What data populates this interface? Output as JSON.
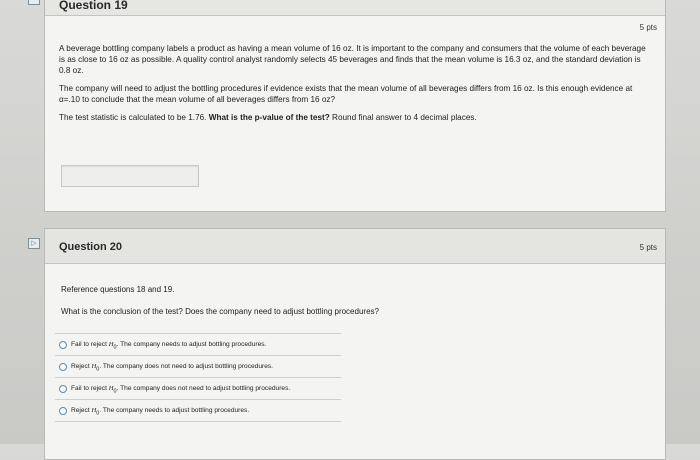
{
  "q19": {
    "title": "Question 19",
    "points": "5 pts",
    "p1": "A beverage bottling company labels a product as having a mean volume of 16 oz. It is important to the company and consumers that the volume of each beverage is as close to 16 oz as possible. A quality control analyst randomly selects 45 beverages and finds that the mean volume is 16.3 oz, and the standard deviation is 0.8 oz.",
    "p2": "The company will need to adjust the bottling procedures if evidence exists that the mean volume of all beverages differs from 16 oz. Is this enough evidence at α=.10 to conclude that the mean volume of all beverages differs from 16 oz?",
    "p3_plain": "The test statistic is calculated to be 1.76.",
    "p3_bold": "What is the p-value of the test?",
    "p3_tail": "Round final answer to 4 decimal places.",
    "answer_value": ""
  },
  "q20": {
    "title": "Question 20",
    "points": "5 pts",
    "reference": "Reference questions 18 and 19.",
    "question": "What is the conclusion of the test? Does the company need to adjust bottling procedures?",
    "choices": [
      {
        "lead": "Fail to reject ",
        "h": "H",
        "sub": "0",
        "rest": ". The company needs to adjust bottling procedures."
      },
      {
        "lead": "Reject ",
        "h": "H",
        "sub": "0",
        "rest": ". The company does not need to adjust bottling procedures."
      },
      {
        "lead": "Fail to reject ",
        "h": "H",
        "sub": "0",
        "rest": ". The company does not need to adjust bottling procedures."
      },
      {
        "lead": "Reject ",
        "h": "H",
        "sub": "0",
        "rest": ". The company needs to adjust bottling procedures."
      }
    ]
  },
  "markers": {
    "q20_marker_glyph": "▷"
  }
}
